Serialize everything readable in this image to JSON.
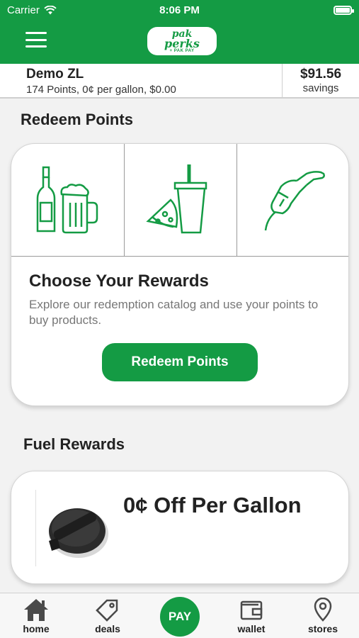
{
  "status_bar": {
    "carrier": "Carrier",
    "time": "8:06 PM"
  },
  "header": {
    "logo": {
      "line1": "pak",
      "line2": "perks",
      "line3": "+ PAK PAY"
    },
    "menu_icon": "hamburger-icon"
  },
  "account": {
    "name": "Demo ZL",
    "summary": "174 Points, 0¢ per gallon, $0.00",
    "savings_amount": "$91.56",
    "savings_label": "savings"
  },
  "redeem_section": {
    "title": "Redeem Points",
    "icons": [
      "beer-bottle-icon",
      "pizza-drink-icon",
      "fuel-nozzle-icon"
    ],
    "card_title": "Choose Your Rewards",
    "card_description": "Explore our redemption catalog and use your points to buy products.",
    "button_label": "Redeem Points"
  },
  "fuel_section": {
    "title": "Fuel Rewards",
    "offer_text": "0¢ Off Per Gallon"
  },
  "bottom_nav": {
    "items": [
      {
        "label": "home",
        "icon": "home-icon"
      },
      {
        "label": "deals",
        "icon": "tag-icon"
      },
      {
        "label": "PAY",
        "icon": "pay-icon"
      },
      {
        "label": "wallet",
        "icon": "wallet-icon"
      },
      {
        "label": "stores",
        "icon": "location-pin-icon"
      }
    ]
  },
  "colors": {
    "brand_green": "#149b44",
    "background": "#f2f2f2"
  }
}
